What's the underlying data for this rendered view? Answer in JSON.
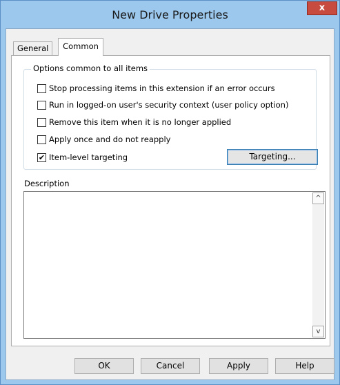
{
  "window": {
    "title": "New Drive Properties",
    "close_glyph": "x"
  },
  "tabs": [
    {
      "label": "General",
      "selected": false
    },
    {
      "label": "Common",
      "selected": true
    }
  ],
  "options_group": {
    "legend": "Options common to all items",
    "items": [
      {
        "label": "Stop processing items in this extension if an error occurs",
        "checked": false
      },
      {
        "label": "Run in logged-on user's security context (user policy option)",
        "checked": false
      },
      {
        "label": "Remove this item when it is no longer applied",
        "checked": false
      },
      {
        "label": "Apply once and do not reapply",
        "checked": false
      },
      {
        "label": "Item-level targeting",
        "checked": true
      }
    ],
    "targeting_button": "Targeting..."
  },
  "description": {
    "label": "Description",
    "value": ""
  },
  "buttons": {
    "ok": "OK",
    "cancel": "Cancel",
    "apply": "Apply",
    "help": "Help"
  },
  "colors": {
    "title_bar": "#9cc8ee",
    "close_button": "#c74b3e"
  },
  "icons": {
    "checkmark": "✔",
    "scroll_up": "^",
    "scroll_down": "v"
  }
}
